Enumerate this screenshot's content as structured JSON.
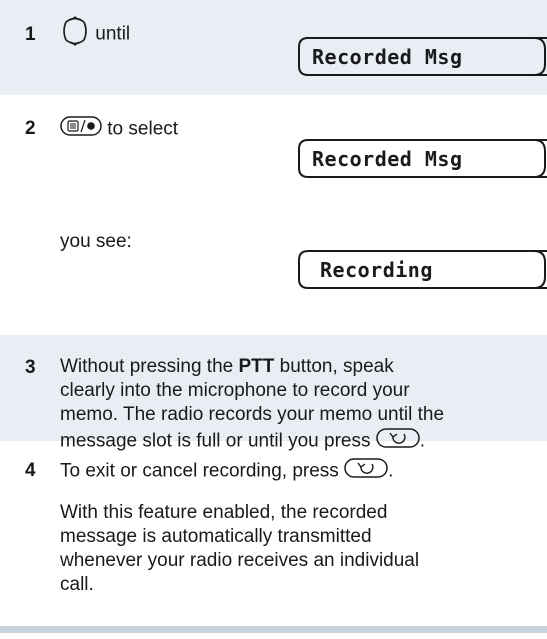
{
  "steps": [
    {
      "number": "1",
      "icon": "scroll-arrows-icon",
      "text": "until",
      "display": "Recorded Msg"
    },
    {
      "number": "2",
      "icon": "menu-select-key-icon",
      "text": "to select",
      "display": "Recorded Msg",
      "see_label": "you see:",
      "see_display": "Recording"
    },
    {
      "number": "3",
      "line1_pre": "Without pressing the ",
      "ptt": "PTT",
      "line1_post": " button, speak",
      "line2": "clearly into the microphone to record your",
      "line3": "memo. The radio records your memo until the",
      "line4": "message slot is full or until you press",
      "line4_end": ".",
      "icon": "exit-key-icon"
    },
    {
      "number": "4",
      "line1": "To exit or cancel recording, press",
      "line1_end": ".",
      "icon": "exit-key-icon",
      "note_lines": [
        "With this feature enabled, the recorded",
        "message is automatically transmitted",
        "whenever your radio receives an individual",
        "call."
      ]
    }
  ],
  "colors": {
    "band": "#e8eef3",
    "rule": "#c6d2dc"
  }
}
